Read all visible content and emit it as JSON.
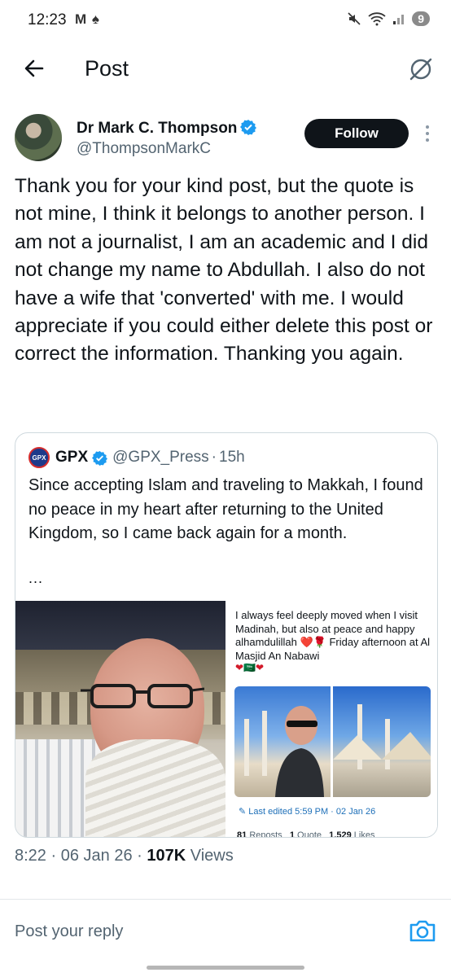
{
  "status_bar": {
    "time": "12:23",
    "left_icons": "M ♠",
    "battery": "9"
  },
  "header": {
    "title": "Post"
  },
  "post": {
    "author_name": "Dr Mark C. Thompson",
    "author_handle": "@ThompsonMarkC",
    "follow_label": "Follow",
    "text": "Thank you for your kind post, but the quote is not mine, I think it belongs to another person. I am not a journalist, I am an academic and I did not change my name to Abdullah. I also do not have a wife that 'converted' with me. I would appreciate if you could either delete this post or correct the information. Thanking you again.",
    "time": "8:22",
    "date": "06 Jan 26",
    "views": "107K",
    "views_label": "Views"
  },
  "quote": {
    "avatar_text": "GPX",
    "name": "GPX",
    "handle": "@GPX_Press",
    "age": "15h",
    "text": "Since accepting Islam and traveling to Makkah, I found no peace in my heart after returning to the United Kingdom, so I came back again for a month.",
    "ellipsis": "...",
    "screenshot": {
      "text": "I always feel deeply moved when I visit Madinah, but also at peace and happy alhamdulillah ❤️🌹 Friday afternoon at Al Masjid An Nabawi",
      "emoji": "❤🇸🇦❤",
      "edited": "Last edited 5:59 PM · 02 Jan 26",
      "reposts": "81",
      "reposts_label": "Reposts",
      "quotes": "1",
      "quotes_label": "Quote",
      "likes": "1,529",
      "likes_label": "Likes"
    }
  },
  "reply": {
    "placeholder": "Post your reply"
  },
  "colors": {
    "accent": "#1d9bf0",
    "text": "#0f1419",
    "muted": "#536471",
    "follow_bg": "#0f1419"
  },
  "icons": [
    "back-arrow-icon",
    "grok-icon",
    "verified-badge-icon",
    "more-icon",
    "camera-icon"
  ]
}
